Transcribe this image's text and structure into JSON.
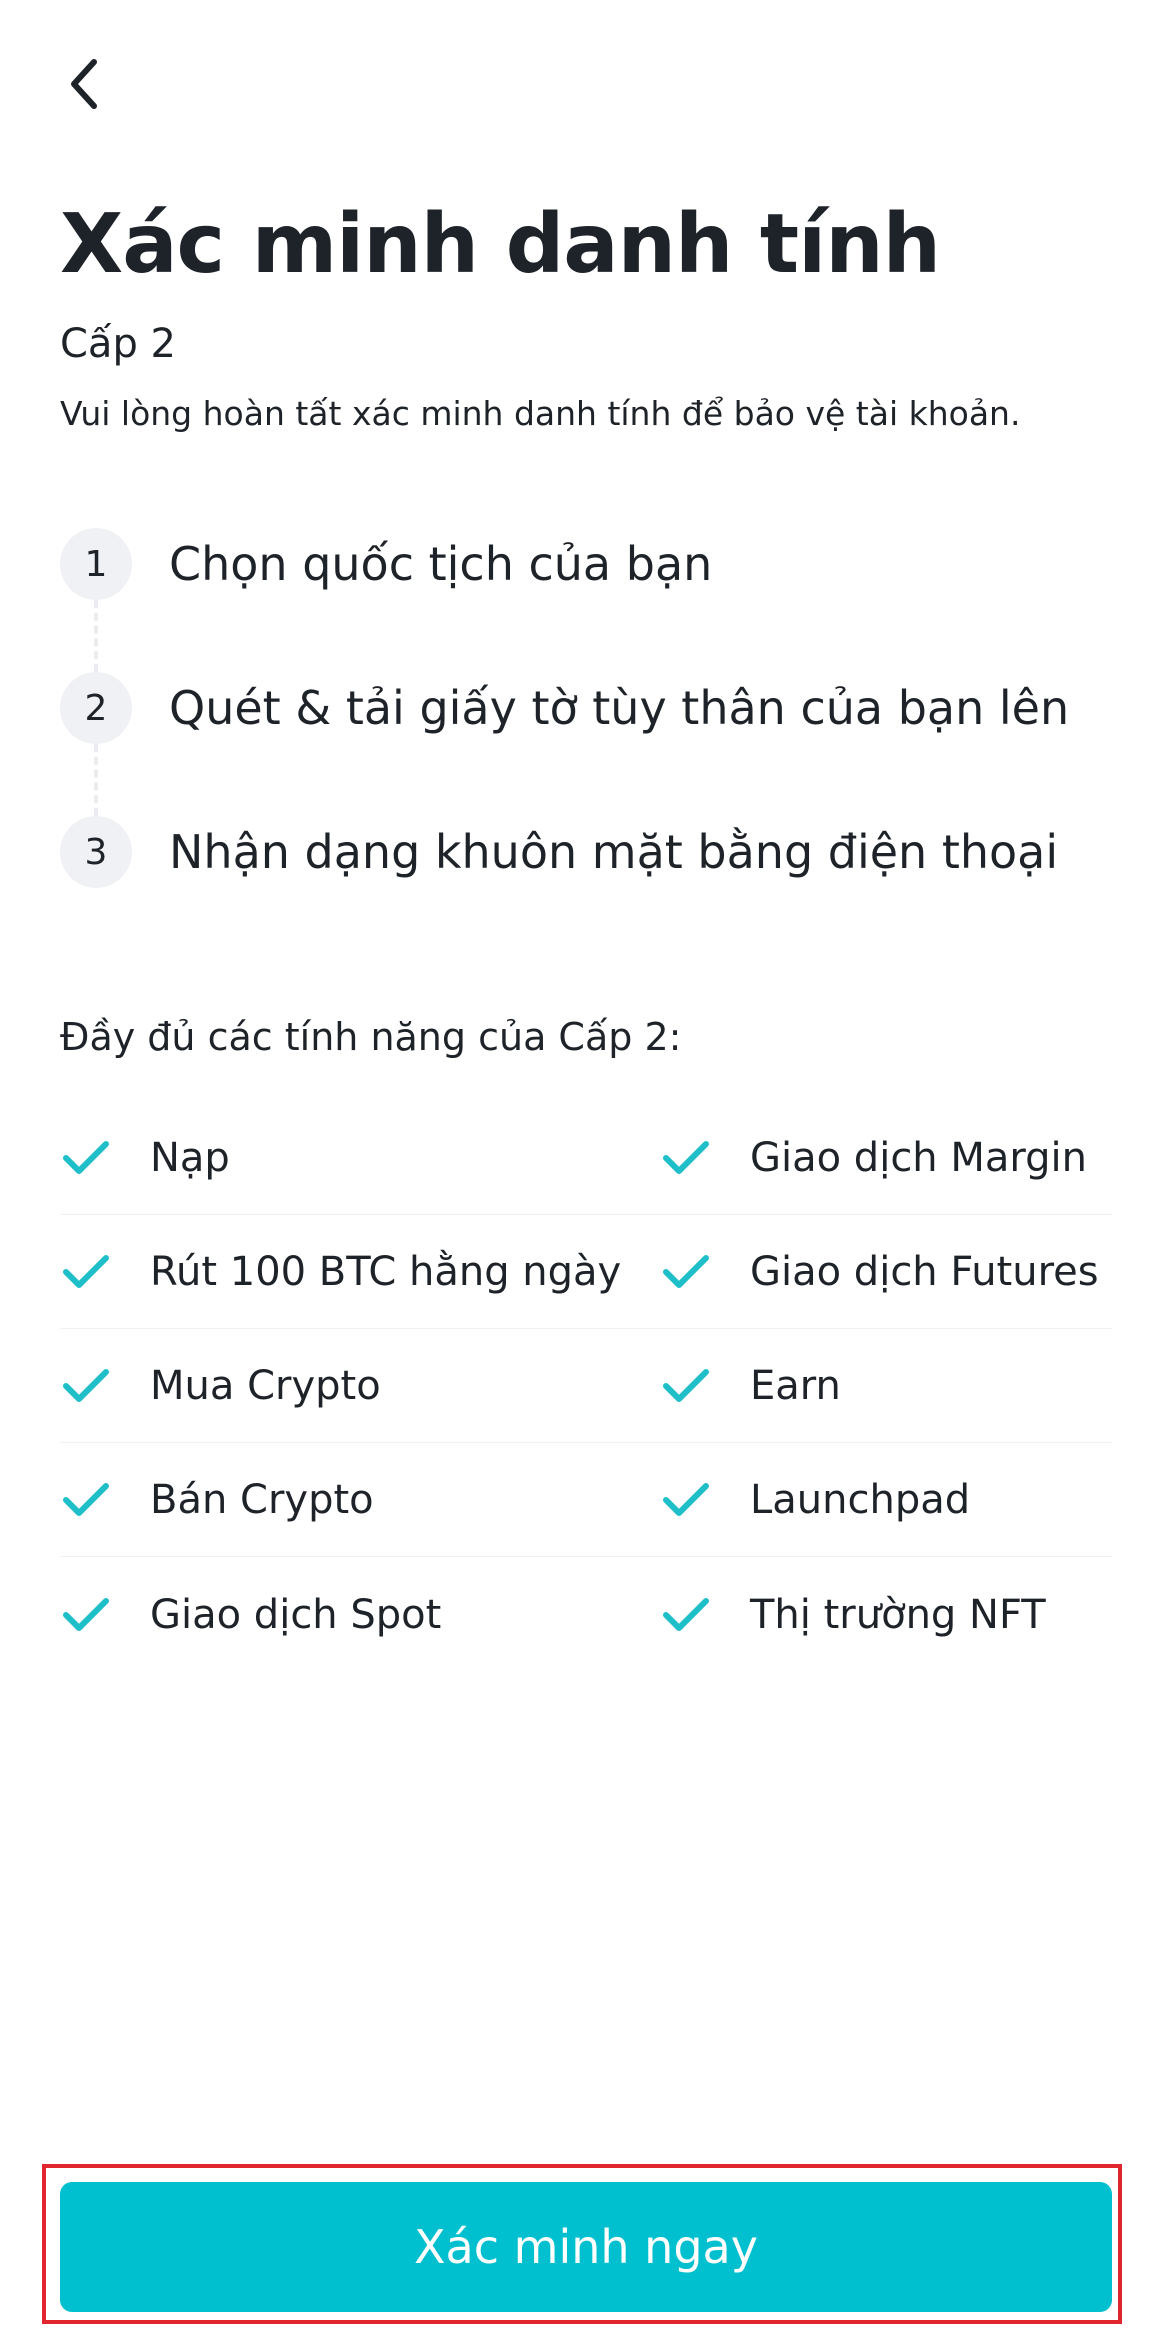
{
  "header": {
    "back_icon": "chevron-left-icon"
  },
  "page": {
    "title": "Xác minh danh tính",
    "level": "Cấp 2",
    "description": "Vui lòng hoàn tất xác minh danh tính để bảo vệ tài khoản."
  },
  "steps": [
    {
      "number": "1",
      "label": "Chọn quốc tịch của bạn"
    },
    {
      "number": "2",
      "label": "Quét & tải giấy tờ tùy thân của bạn lên"
    },
    {
      "number": "3",
      "label": "Nhận dạng khuôn mặt bằng điện thoại"
    }
  ],
  "features": {
    "heading": "Đầy đủ các tính năng của Cấp 2:",
    "check_icon": "checkmark-icon",
    "check_color": "#1ebfc9",
    "rows": [
      {
        "left": "Nạp",
        "right": "Giao dịch Margin"
      },
      {
        "left": "Rút 100 BTC hằng ngày",
        "right": "Giao dịch Futures"
      },
      {
        "left": "Mua Crypto",
        "right": "Earn"
      },
      {
        "left": "Bán Crypto",
        "right": "Launchpad"
      },
      {
        "left": "Giao dịch Spot",
        "right": "Thị trường NFT"
      }
    ]
  },
  "cta": {
    "label": "Xác minh ngay",
    "color": "#00c0cf",
    "highlight_color": "#e0252e"
  }
}
